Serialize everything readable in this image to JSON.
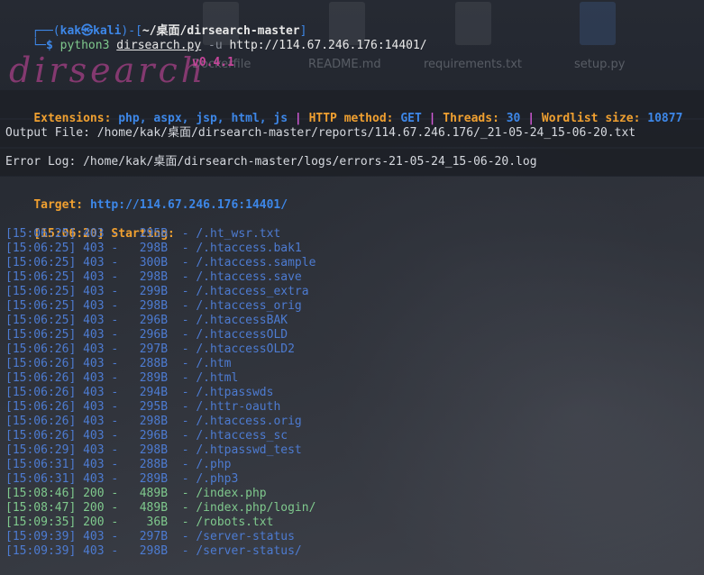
{
  "terminal": {
    "prompt": {
      "line1_prefix": "┌──(",
      "user": "kak㉿kali",
      "line1_mid": ")-[",
      "cwd": "~/桌面/dirsearch-master",
      "line1_suffix": "]",
      "line2_prefix": "└─",
      "dollar": "$",
      "cmd": "python3",
      "script": "dirsearch.py",
      "flag": "-u",
      "url": "http://114.67.246.176:14401/"
    },
    "banner": {
      "logo_text": "dirsearch",
      "version": "v0.4.1"
    },
    "config": {
      "extensions_label": "Extensions:",
      "extensions_value": "php, aspx, jsp, html, js",
      "sep": "|",
      "method_label": "HTTP method:",
      "method_value": "GET",
      "threads_label": "Threads:",
      "threads_value": "30",
      "wordlist_label": "Wordlist size:",
      "wordlist_value": "10877"
    },
    "output_file": "Output File: /home/kak/桌面/dirsearch-master/reports/114.67.246.176/_21-05-24_15-06-20.txt",
    "error_log": "Error Log: /home/kak/桌面/dirsearch-master/logs/errors-21-05-24_15-06-20.log",
    "target_label": "Target:",
    "target_url": "http://114.67.246.176:14401/",
    "start_time": "[15:06:20]",
    "start_text": "Starting:",
    "results": [
      {
        "time": "[15:06:25]",
        "code": "403",
        "size": "295B",
        "path": "/.ht_wsr.txt"
      },
      {
        "time": "[15:06:25]",
        "code": "403",
        "size": "298B",
        "path": "/.htaccess.bak1"
      },
      {
        "time": "[15:06:25]",
        "code": "403",
        "size": "300B",
        "path": "/.htaccess.sample"
      },
      {
        "time": "[15:06:25]",
        "code": "403",
        "size": "298B",
        "path": "/.htaccess.save"
      },
      {
        "time": "[15:06:25]",
        "code": "403",
        "size": "299B",
        "path": "/.htaccess_extra"
      },
      {
        "time": "[15:06:25]",
        "code": "403",
        "size": "298B",
        "path": "/.htaccess_orig"
      },
      {
        "time": "[15:06:25]",
        "code": "403",
        "size": "296B",
        "path": "/.htaccessBAK"
      },
      {
        "time": "[15:06:25]",
        "code": "403",
        "size": "296B",
        "path": "/.htaccessOLD"
      },
      {
        "time": "[15:06:26]",
        "code": "403",
        "size": "297B",
        "path": "/.htaccessOLD2"
      },
      {
        "time": "[15:06:26]",
        "code": "403",
        "size": "288B",
        "path": "/.htm"
      },
      {
        "time": "[15:06:26]",
        "code": "403",
        "size": "289B",
        "path": "/.html"
      },
      {
        "time": "[15:06:26]",
        "code": "403",
        "size": "294B",
        "path": "/.htpasswds"
      },
      {
        "time": "[15:06:26]",
        "code": "403",
        "size": "295B",
        "path": "/.httr-oauth"
      },
      {
        "time": "[15:06:26]",
        "code": "403",
        "size": "298B",
        "path": "/.htaccess.orig"
      },
      {
        "time": "[15:06:26]",
        "code": "403",
        "size": "296B",
        "path": "/.htaccess_sc"
      },
      {
        "time": "[15:06:29]",
        "code": "403",
        "size": "298B",
        "path": "/.htpasswd_test"
      },
      {
        "time": "[15:06:31]",
        "code": "403",
        "size": "288B",
        "path": "/.php"
      },
      {
        "time": "[15:06:31]",
        "code": "403",
        "size": "289B",
        "path": "/.php3"
      },
      {
        "time": "[15:08:46]",
        "code": "200",
        "size": "489B",
        "path": "/index.php"
      },
      {
        "time": "[15:08:47]",
        "code": "200",
        "size": "489B",
        "path": "/index.php/login/"
      },
      {
        "time": "[15:09:35]",
        "code": "200",
        "size": "36B",
        "path": "/robots.txt"
      },
      {
        "time": "[15:09:39]",
        "code": "403",
        "size": "297B",
        "path": "/server-status"
      },
      {
        "time": "[15:09:39]",
        "code": "403",
        "size": "298B",
        "path": "/server-status/"
      }
    ]
  },
  "desktop": {
    "icons": [
      {
        "label": "Dockerfile",
        "icon": "file-icon"
      },
      {
        "label": "README.md",
        "icon": "file-icon"
      },
      {
        "label": "requirements.txt",
        "icon": "file-icon"
      },
      {
        "label": "setup.py",
        "icon": "python-file-icon"
      }
    ]
  },
  "colors": {
    "orange": "#f0a030",
    "blue": "#3d87e8",
    "magenta": "#d35ad8",
    "green": "#7fc98d"
  }
}
